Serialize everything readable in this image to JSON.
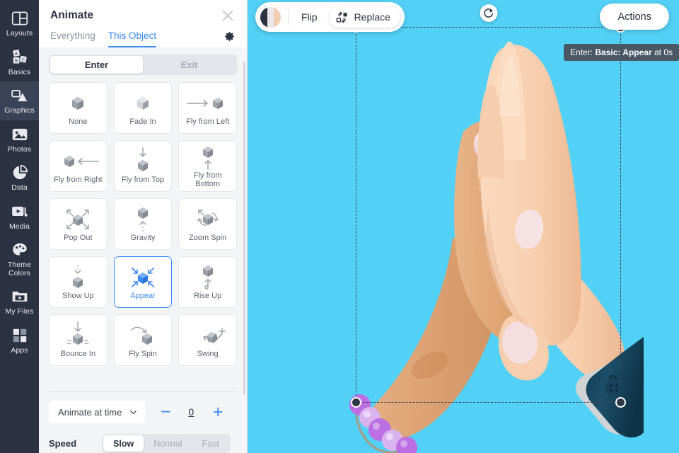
{
  "sidebar": {
    "items": [
      {
        "label": "Layouts",
        "icon": "layouts-icon",
        "active": false
      },
      {
        "label": "Basics",
        "icon": "basics-icon",
        "active": false
      },
      {
        "label": "Graphics",
        "icon": "graphics-icon",
        "active": true
      },
      {
        "label": "Photos",
        "icon": "photos-icon",
        "active": false
      },
      {
        "label": "Data",
        "icon": "data-icon",
        "active": false
      },
      {
        "label": "Media",
        "icon": "media-icon",
        "active": false
      },
      {
        "label": "Theme Colors",
        "icon": "theme-colors-icon",
        "active": false
      },
      {
        "label": "My Files",
        "icon": "my-files-icon",
        "active": false
      },
      {
        "label": "Apps",
        "icon": "apps-icon",
        "active": false
      }
    ]
  },
  "panel": {
    "title": "Animate",
    "close_icon": "close-icon",
    "settings_icon": "gear-icon",
    "tabs": [
      {
        "label": "Everything",
        "active": false
      },
      {
        "label": "This Object",
        "active": true
      }
    ],
    "mode_segments": [
      {
        "label": "Enter",
        "active": true
      },
      {
        "label": "Exit",
        "active": false
      }
    ],
    "animations": [
      {
        "label": "None",
        "icon": "cube-plain-icon",
        "selected": false
      },
      {
        "label": "Fade In",
        "icon": "cube-fade-icon",
        "selected": false
      },
      {
        "label": "Fly from Left",
        "icon": "arrow-right-cube-icon",
        "selected": false
      },
      {
        "label": "Fly from Right",
        "icon": "cube-arrow-left-icon",
        "selected": false
      },
      {
        "label": "Fly from Top",
        "icon": "arrow-down-cube-icon",
        "selected": false
      },
      {
        "label": "Fly from Bottom",
        "icon": "cube-arrow-up-icon",
        "selected": false
      },
      {
        "label": "Pop Out",
        "icon": "cube-expand-icon",
        "selected": false
      },
      {
        "label": "Gravity",
        "icon": "cube-dashed-up-icon",
        "selected": false
      },
      {
        "label": "Zoom Spin",
        "icon": "cube-spin-icon",
        "selected": false
      },
      {
        "label": "Show Up",
        "icon": "dashed-down-cube-icon",
        "selected": false
      },
      {
        "label": "Appear",
        "icon": "cube-contract-icon",
        "selected": true
      },
      {
        "label": "Rise Up",
        "icon": "cube-curl-up-icon",
        "selected": false
      },
      {
        "label": "Bounce In",
        "icon": "cube-bounce-icon",
        "selected": false
      },
      {
        "label": "Fly Spin",
        "icon": "cube-fly-spin-icon",
        "selected": false
      },
      {
        "label": "Swing",
        "icon": "cube-swing-icon",
        "selected": false
      }
    ],
    "timing": {
      "mode_label": "Animate at time",
      "dropdown_icon": "chevron-down-icon",
      "decrement_label": "−",
      "increment_label": "+",
      "value": "0"
    },
    "speed": {
      "label": "Speed",
      "options": [
        {
          "label": "Slow",
          "active": true
        },
        {
          "label": "Normal",
          "active": false
        },
        {
          "label": "Fast",
          "active": false
        }
      ]
    }
  },
  "canvas": {
    "background_color": "#52d0f5",
    "toolbar": {
      "swatch_icon": "color-swatch-icon",
      "flip_label": "Flip",
      "replace_icon": "replace-icon",
      "replace_label": "Replace"
    },
    "actions_label": "Actions",
    "tooltip": {
      "prefix": "Enter: ",
      "strong": "Basic: Appear",
      "suffix": " at 0s"
    },
    "rotate_icon": "rotate-icon",
    "object": {
      "name": "praying-hands-graphic",
      "skin_light": "#f7c9a8",
      "skin_dark": "#e8a878",
      "nail_color": "#f2d2d8",
      "cuff_color": "#1d4a63",
      "bracelet_color": "#b566e0"
    }
  },
  "accent": {
    "blue": "#3b8bf5",
    "rail_bg": "#2b3242",
    "panel_bg": "#f3f4f6"
  }
}
